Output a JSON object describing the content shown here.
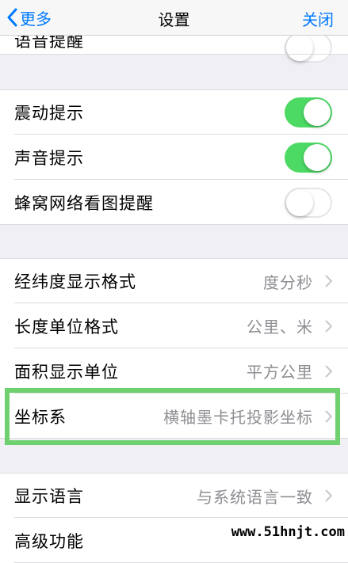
{
  "nav": {
    "back_label": "更多",
    "title": "设置",
    "close_label": "关闭"
  },
  "group1": {
    "partial_label": "语音提醒",
    "partial_on": false
  },
  "group2": {
    "rows": [
      {
        "label": "震动提示",
        "on": true
      },
      {
        "label": "声音提示",
        "on": true
      },
      {
        "label": "蜂窝网络看图提醒",
        "on": false
      }
    ]
  },
  "group3": {
    "rows": [
      {
        "label": "经纬度显示格式",
        "value": "度分秒"
      },
      {
        "label": "长度单位格式",
        "value": "公里、米"
      },
      {
        "label": "面积显示单位",
        "value": "平方公里"
      },
      {
        "label": "坐标系",
        "value": "横轴墨卡托投影坐标"
      }
    ]
  },
  "group4": {
    "rows": [
      {
        "label": "显示语言",
        "value": "与系统语言一致"
      },
      {
        "label": "高级功能",
        "value": ""
      }
    ]
  },
  "watermark": "www.51hnjt.com",
  "colors": {
    "accent": "#007aff",
    "toggle_on": "#4cd964",
    "highlight": "#6fd06f"
  }
}
